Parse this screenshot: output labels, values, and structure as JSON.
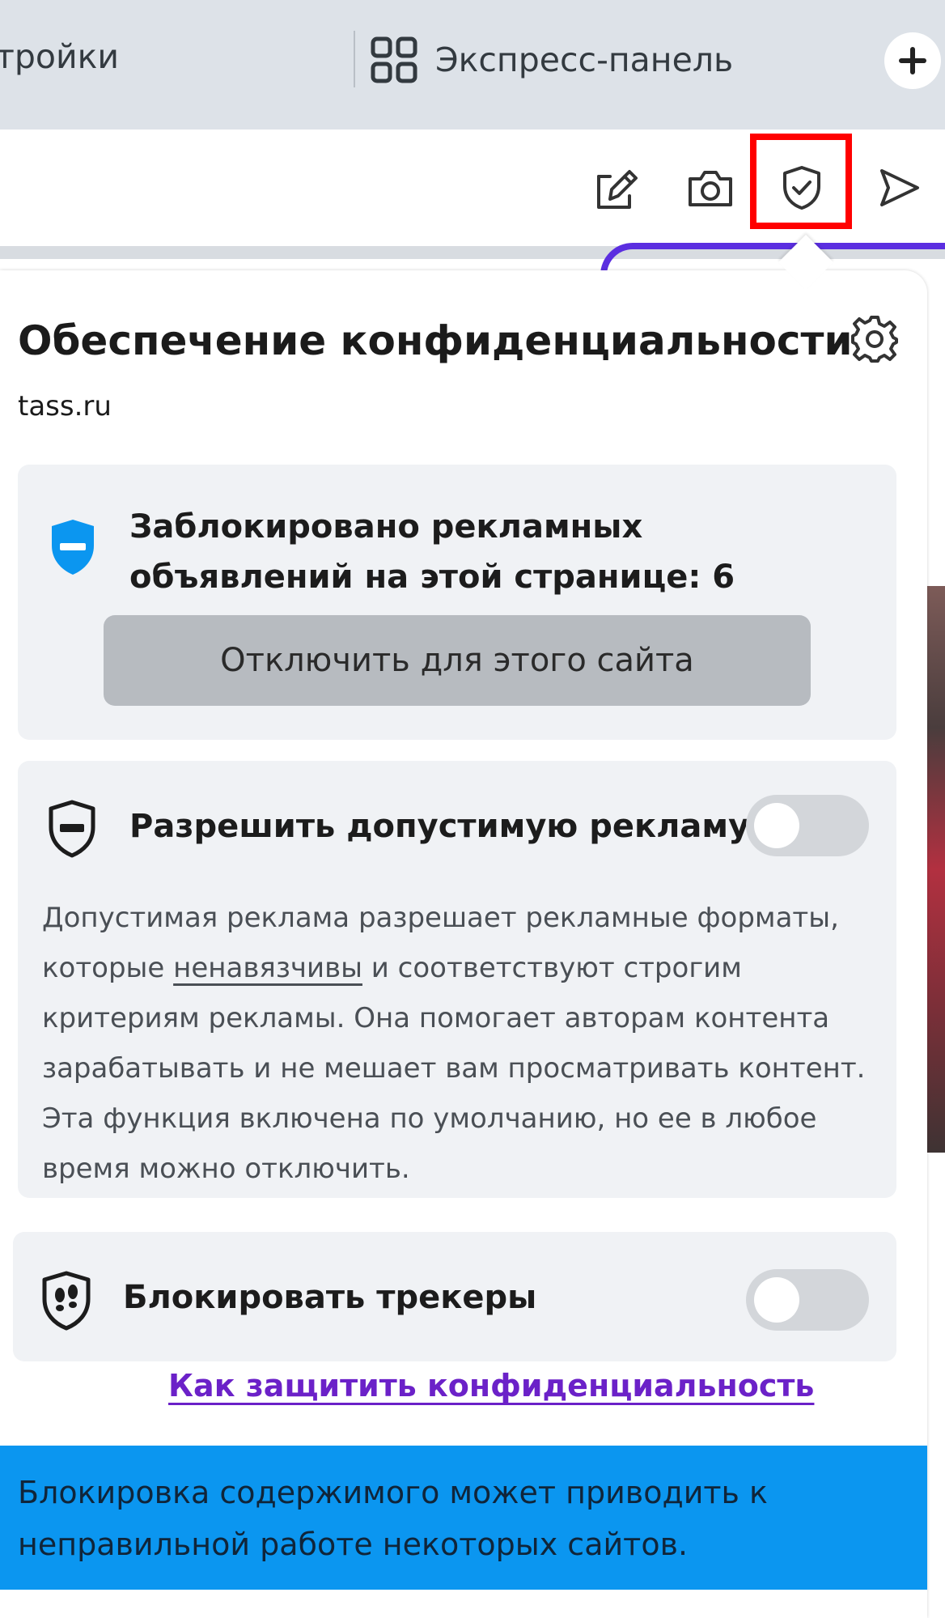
{
  "tabs": {
    "left_partial": "тройки",
    "speed_dial_label": "Экспресс-панель",
    "new_tab_icon": "plus-icon"
  },
  "toolbar": {
    "icons": [
      "edit-snapshot-icon",
      "camera-icon",
      "shield-check-icon",
      "send-icon"
    ],
    "highlight_color": "#ff0000"
  },
  "popup": {
    "title": "Обеспечение конфиденциальности",
    "site": "tass.ru",
    "settings_icon": "gear-icon",
    "adblock": {
      "text": "Заблокировано рекламных объявлений на этой странице: 6",
      "disable_button": "Отключить для этого сайта",
      "icon": "blue-shield-icon"
    },
    "acceptable_ads": {
      "title": "Разрешить допустимую рекламу",
      "enabled": false,
      "desc_before": "Допустимая реклама разрешает рекламные форматы, которые ",
      "desc_link": "ненавязчивы",
      "desc_after": " и соответствуют строгим критериям рекламы. Она помогает авторам контента зарабатывать и не мешает вам просматривать контент. Эта функция включена по умолчанию, но ее в любое время можно отключить."
    },
    "trackers": {
      "title": "Блокировать трекеры",
      "enabled": false
    },
    "help_link": "Как защитить конфиденциальность",
    "warning": "Блокировка содержимого может приводить к неправильной работе некоторых сайтов."
  },
  "colors": {
    "accent_blue": "#0b96f0",
    "link_purple": "#6b21c8",
    "card_bg": "#f0f2f5"
  }
}
